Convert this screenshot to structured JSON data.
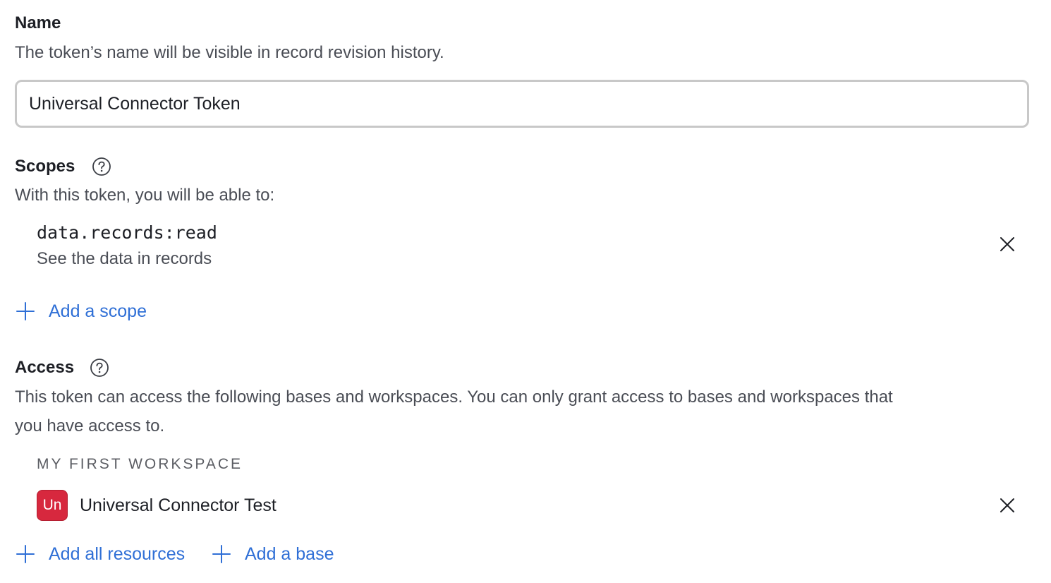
{
  "name_section": {
    "title": "Name",
    "description": "The token’s name will be visible in record revision history.",
    "input_value": "Universal Connector Token"
  },
  "scopes_section": {
    "title": "Scopes",
    "description": "With this token, you will be able to:",
    "scopes": [
      {
        "name": "data.records:read",
        "description": "See the data in records"
      }
    ],
    "add_scope_label": "Add a scope"
  },
  "access_section": {
    "title": "Access",
    "description_line1": "This token can access the following bases and workspaces. You can only grant access to bases and workspaces that",
    "description_line2": "you have access to.",
    "workspace_label": "MY FIRST WORKSPACE",
    "bases": [
      {
        "badge": "Un",
        "name": "Universal Connector Test",
        "badge_color": "#d7283e"
      }
    ],
    "add_all_label": "Add all resources",
    "add_base_label": "Add a base"
  },
  "colors": {
    "link": "#2f6fd6",
    "heading": "#1d1f25",
    "muted": "#4a4d55",
    "input_border": "#c8c8c8"
  },
  "icons": {
    "help": "question-circle-icon",
    "remove": "close-x-icon",
    "add": "plus-icon"
  }
}
